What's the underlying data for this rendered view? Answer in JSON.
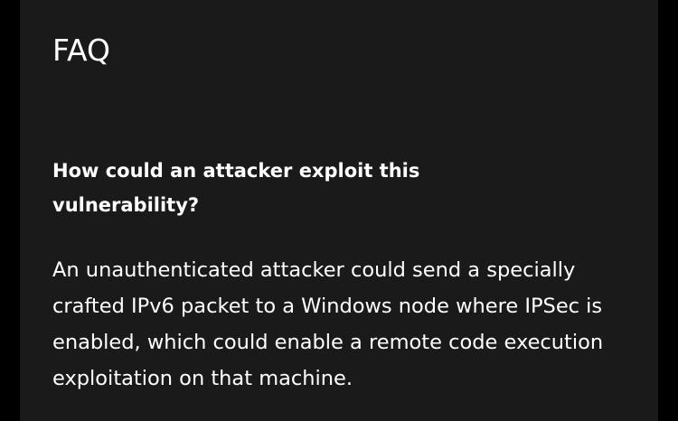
{
  "faq": {
    "title": "FAQ",
    "items": [
      {
        "question": "How could an attacker exploit this vulnerability?",
        "answer": "An unauthenticated attacker could send a specially crafted IPv6 packet to a Windows node where IPSec is enabled, which could enable a remote code execution exploitation on that machine."
      }
    ]
  },
  "colors": {
    "page_background": "#000000",
    "panel_background": "#1b1a1a",
    "text": "#ffffff"
  }
}
